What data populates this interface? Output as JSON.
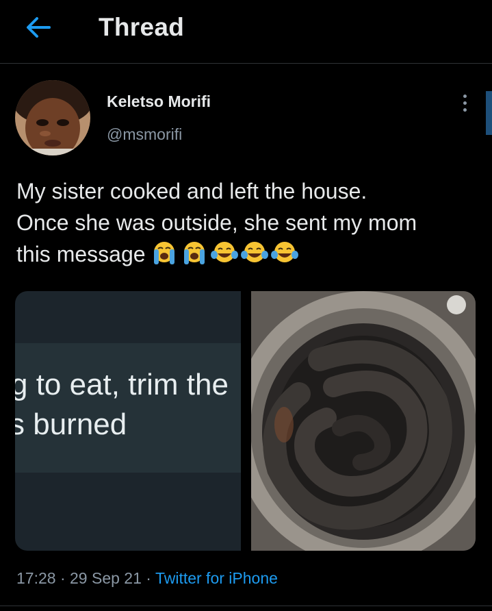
{
  "header": {
    "title": "Thread",
    "back_icon": "arrow-left-icon",
    "accent_color": "#1d9bf0"
  },
  "tweet": {
    "author": {
      "display_name": "Keletso Morifi",
      "handle": "@msmorifi"
    },
    "text_lines": [
      "My sister cooked and left the house.",
      "Once she was outside, she sent my mom",
      "this message"
    ],
    "emojis": [
      "loudly-crying-face",
      "loudly-crying-face",
      "face-with-tears-of-joy",
      "face-with-tears-of-joy",
      "face-with-tears-of-joy"
    ],
    "media": {
      "left_image": {
        "lines": [
          "g to eat, trim the",
          "s burned"
        ]
      },
      "right_image": {
        "subject": "burnt-sausage-in-pot"
      }
    },
    "time": "17:28",
    "date": "29 Sep 21",
    "separator": "·",
    "source": "Twitter for iPhone"
  }
}
